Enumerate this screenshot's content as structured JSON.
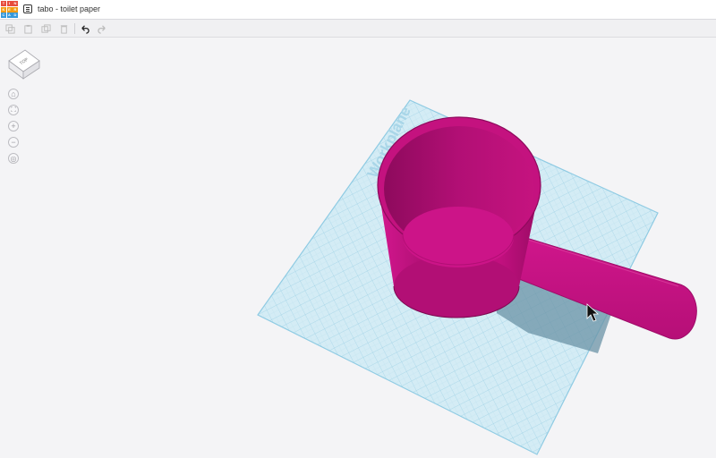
{
  "app": {
    "logo_letters": [
      "T",
      "I",
      "N",
      "K",
      "E",
      "R",
      "C",
      "A",
      "D"
    ],
    "logo_colors": [
      "#e74c3c",
      "#e74c3c",
      "#e74c3c",
      "#f39c12",
      "#f39c12",
      "#f39c12",
      "#3498db",
      "#3498db",
      "#3498db"
    ],
    "title": "tabo - toilet paper"
  },
  "toolbar": {
    "tools": [
      {
        "name": "copy-icon",
        "symbol": "⎘",
        "enabled": false
      },
      {
        "name": "paste-icon",
        "symbol": "📋",
        "enabled": false
      },
      {
        "name": "duplicate-icon",
        "symbol": "❐",
        "enabled": false
      },
      {
        "name": "delete-icon",
        "symbol": "🗑",
        "enabled": false
      },
      {
        "name": "undo-icon",
        "symbol": "↶",
        "enabled": true
      },
      {
        "name": "redo-icon",
        "symbol": "↷",
        "enabled": false
      }
    ]
  },
  "viewcube": {
    "face_label": "TOP"
  },
  "view_controls": [
    {
      "name": "home-view-icon",
      "symbol": "⌂"
    },
    {
      "name": "fit-view-icon",
      "symbol": "⛶"
    },
    {
      "name": "zoom-in-icon",
      "symbol": "+"
    },
    {
      "name": "zoom-out-icon",
      "symbol": "−"
    },
    {
      "name": "perspective-icon",
      "symbol": "◎"
    }
  ],
  "workplane": {
    "label": "Workplane",
    "color": "#cfe8f2",
    "grid_color": "#9cd0e6"
  },
  "model": {
    "color": "#c2107f",
    "dark": "#8e0a5d",
    "light": "#d0168c"
  }
}
